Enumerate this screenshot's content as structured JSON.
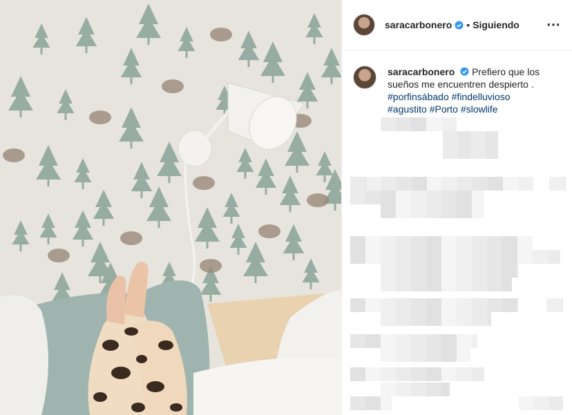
{
  "post": {
    "username": "saracarbonero",
    "follow_status": "Siguiendo",
    "separator": "•",
    "more_icon": "⋯"
  },
  "caption": {
    "username": "saracarbonero",
    "text": "Prefiero que los sueños me encuentren despierto .",
    "hashtags": [
      "#porfinsábado",
      "#findelluvioso",
      "#agustito",
      "#Porto",
      "#slowlife"
    ]
  },
  "colors": {
    "accent": "#3897f0",
    "hashtag": "#00376b",
    "wallpaper": "#e8e6df",
    "tree": "#8fa89c"
  },
  "photo": {
    "alt_icon": "photo-image"
  }
}
